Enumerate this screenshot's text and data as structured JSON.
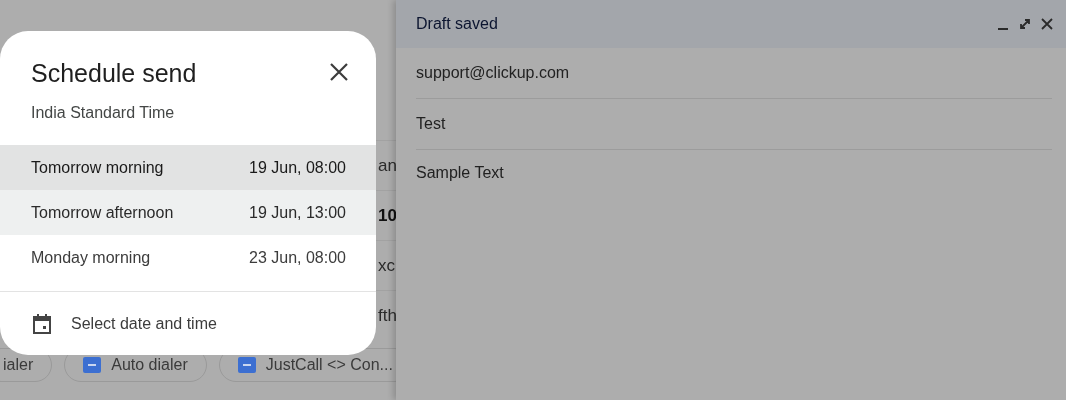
{
  "background": {
    "row_fragments": [
      {
        "text": "an",
        "bold": false
      },
      {
        "text": "10",
        "bold": true
      },
      {
        "text": "xc",
        "bold": false
      },
      {
        "text": "fth",
        "bold": false
      }
    ],
    "chips": [
      {
        "label": "ialer",
        "icon": false
      },
      {
        "label": "Auto dialer",
        "icon": true
      },
      {
        "label": "JustCall <> Con...",
        "icon": true
      }
    ]
  },
  "dialog": {
    "title": "Schedule send",
    "subtitle": "India Standard Time",
    "options": [
      {
        "label": "Tomorrow morning",
        "time": "19 Jun, 08:00",
        "selected": true,
        "focused": false
      },
      {
        "label": "Tomorrow afternoon",
        "time": "19 Jun, 13:00",
        "selected": false,
        "focused": true
      },
      {
        "label": "Monday morning",
        "time": "23 Jun, 08:00",
        "selected": false,
        "focused": false
      }
    ],
    "custom": {
      "label": "Select date and time"
    }
  },
  "compose": {
    "title": "Draft saved",
    "to": "support@clickup.com",
    "subject": "Test",
    "body": "Sample Text"
  }
}
